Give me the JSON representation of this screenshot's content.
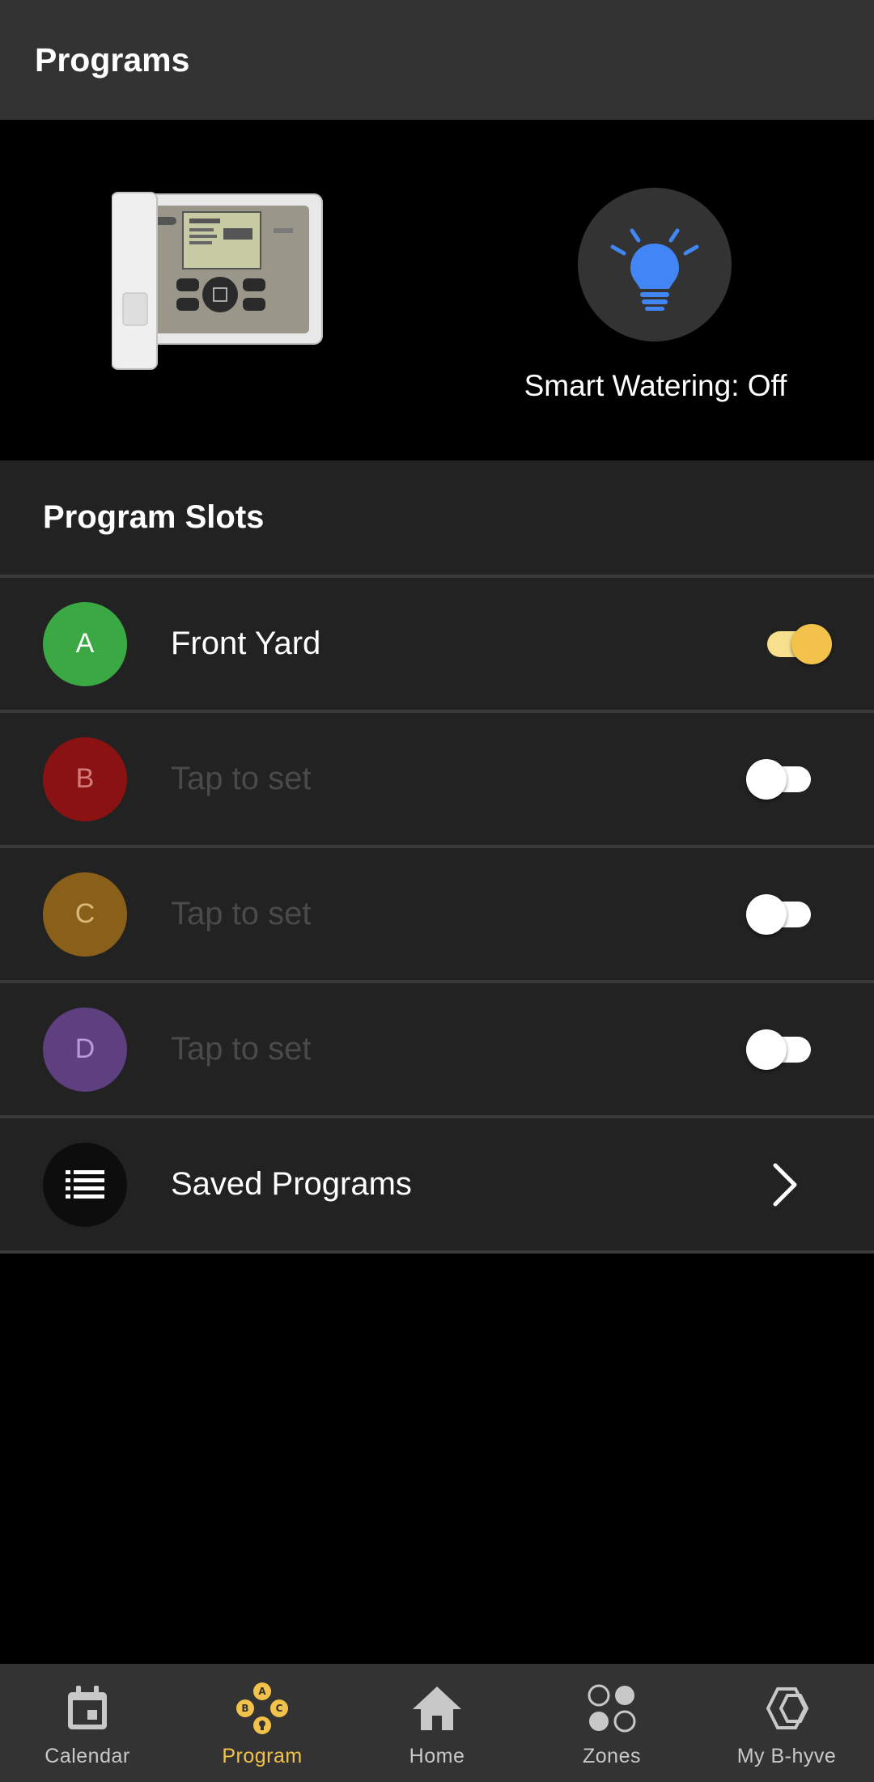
{
  "app_bar": {
    "title": "Programs"
  },
  "hero": {
    "smart_watering_label": "Smart Watering: Off",
    "icon": "lightbulb-icon",
    "icon_color": "#4285F4"
  },
  "section": {
    "title": "Program Slots"
  },
  "slots": [
    {
      "letter": "A",
      "label": "Front Yard",
      "is_set": true,
      "enabled": true,
      "color": "#3aa943"
    },
    {
      "letter": "B",
      "label": "Tap to set",
      "is_set": false,
      "enabled": false,
      "color": "#8a1212"
    },
    {
      "letter": "C",
      "label": "Tap to set",
      "is_set": false,
      "enabled": false,
      "color": "#8a5f1a"
    },
    {
      "letter": "D",
      "label": "Tap to set",
      "is_set": false,
      "enabled": false,
      "color": "#5e3f80"
    }
  ],
  "saved_programs": {
    "label": "Saved Programs",
    "icon": "list-icon"
  },
  "bottom_nav": {
    "items": [
      {
        "label": "Calendar",
        "icon": "calendar-icon",
        "active": false
      },
      {
        "label": "Program",
        "icon": "program-abc-icon",
        "active": true
      },
      {
        "label": "Home",
        "icon": "home-icon",
        "active": false
      },
      {
        "label": "Zones",
        "icon": "zones-icon",
        "active": false
      },
      {
        "label": "My B-hyve",
        "icon": "b-hyve-icon",
        "active": false
      }
    ]
  },
  "colors": {
    "accent": "#f3c24b",
    "toggle_on_track": "#f6e08e",
    "toggle_off_track": "#ffffff",
    "placeholder_text": "#4a4a4a"
  }
}
